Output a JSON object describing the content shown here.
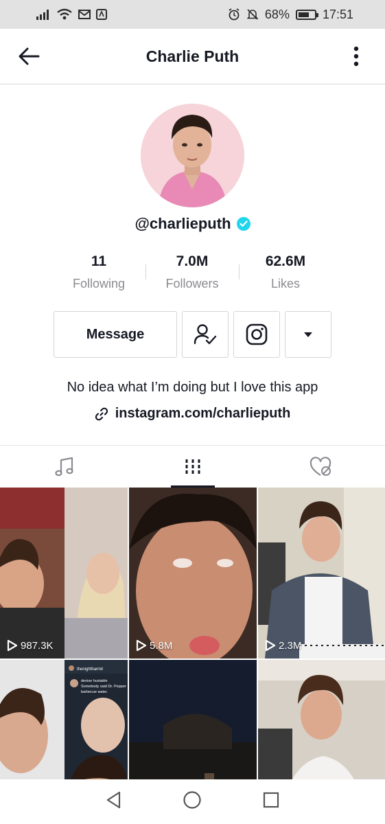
{
  "status_bar": {
    "battery": "68%",
    "battery_level": 0.68,
    "time": "17:51",
    "icons": [
      "signal-icon",
      "wifi-icon",
      "mail-icon",
      "app-notification-icon",
      "alarm-icon",
      "mute-icon",
      "battery-icon"
    ]
  },
  "header": {
    "title": "Charlie Puth",
    "back_icon": "arrow-left-icon",
    "more_icon": "vertical-dots-icon"
  },
  "profile": {
    "handle": "@charlieputh",
    "verified": true,
    "stats": [
      {
        "value": "11",
        "label": "Following"
      },
      {
        "value": "7.0M",
        "label": "Followers"
      },
      {
        "value": "62.6M",
        "label": "Likes"
      }
    ],
    "message_label": "Message",
    "bio": "No idea what I’m doing but I love this app",
    "link": "instagram.com/charlieputh"
  },
  "tabs": [
    {
      "icon": "music-note-icon",
      "active": false
    },
    {
      "icon": "video-grid-icon",
      "active": true
    },
    {
      "icon": "liked-private-icon",
      "active": false
    }
  ],
  "videos": [
    {
      "views": "987.3K"
    },
    {
      "views": "5.8M"
    },
    {
      "views": "2.3M"
    },
    {
      "views": ""
    },
    {
      "views": ""
    },
    {
      "views": ""
    }
  ],
  "tweet_overlay": {
    "account": "thenightharmit",
    "author": "denise huxtable",
    "text1": "Somebody said Dr. Pepper",
    "text2": "barbecue water."
  },
  "colors": {
    "accent_verified": "#20d5ec",
    "text_primary": "#161823",
    "text_secondary": "#8a8b91",
    "status_bar_bg": "#e2e2e2"
  }
}
